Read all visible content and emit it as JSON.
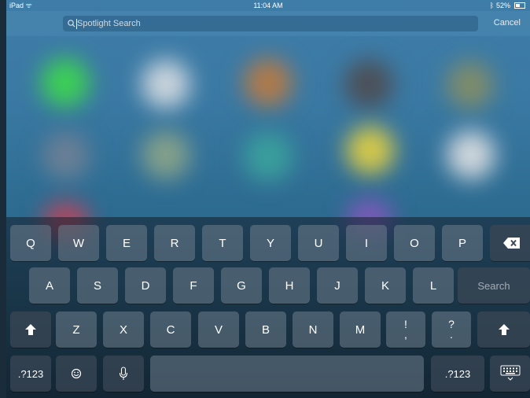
{
  "statusbar": {
    "device": "iPad",
    "time": "11:04 AM",
    "battery": "52%"
  },
  "search": {
    "placeholder": "Spotlight Search",
    "value": "",
    "cancel_label": "Cancel"
  },
  "keyboard": {
    "row1": [
      "Q",
      "W",
      "E",
      "R",
      "T",
      "Y",
      "U",
      "I",
      "O",
      "P"
    ],
    "row2": [
      "A",
      "S",
      "D",
      "F",
      "G",
      "H",
      "J",
      "K",
      "L"
    ],
    "row3": [
      "Z",
      "X",
      "C",
      "V",
      "B",
      "N",
      "M"
    ],
    "row3_punct": [
      {
        "top": "!",
        "bottom": ","
      },
      {
        "top": "?",
        "bottom": "."
      }
    ],
    "search_label": "Search",
    "numbers_label": ".?123",
    "icons": {
      "delete": "delete-icon",
      "shift": "shift-icon",
      "emoji": "emoji-icon",
      "mic": "microphone-icon",
      "hide": "keyboard-hide-icon"
    }
  },
  "colors": {
    "wallpaper": "#3a79a3",
    "key": "#6e7d8c",
    "key_dark": "#3c4856"
  }
}
